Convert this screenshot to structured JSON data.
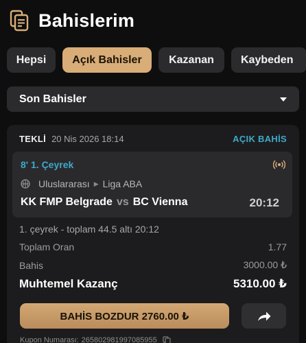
{
  "header": {
    "title": "Bahislerim",
    "icon": "betslip-icon"
  },
  "tabs": [
    {
      "label": "Hepsi",
      "active": false
    },
    {
      "label": "Açık Bahisler",
      "active": true
    },
    {
      "label": "Kazanan",
      "active": false
    },
    {
      "label": "Kaybeden",
      "active": false
    }
  ],
  "filter": {
    "selected": "Son Bahisler",
    "icon": "caret-down-icon"
  },
  "bet": {
    "type": "TEKLİ",
    "date": "20 Nis 2026 18:14",
    "status": "AÇIK BAHİS",
    "event": {
      "period": "8' 1. Çeyrek",
      "live_icon": "live-broadcast-icon",
      "sport_icon": "basketball-icon",
      "region": "Uluslararası",
      "league": "Liga ABA",
      "home": "KK FMP Belgrade",
      "vs": "vs",
      "away": "BC Vienna",
      "score": "20:12"
    },
    "selection": "1. çeyrek - toplam 44.5 altı  20:12",
    "total_odds_label": "Toplam Oran",
    "total_odds": "1.77",
    "stake_label": "Bahis",
    "stake": "3000.00 ₺",
    "potential_label": "Muhtemel Kazanç",
    "potential": "5310.00 ₺",
    "cashout_label": "BAHİS BOZDUR 2760.00 ₺",
    "share_icon": "share-arrow-icon",
    "coupon_label": "Kupon Numarası:",
    "coupon_number": "265802981997085955",
    "copy_icon": "copy-icon"
  },
  "colors": {
    "accent": "#d9ad77",
    "status": "#3fa9c9",
    "background": "#0e0e0f",
    "card": "#1c1c1e"
  }
}
